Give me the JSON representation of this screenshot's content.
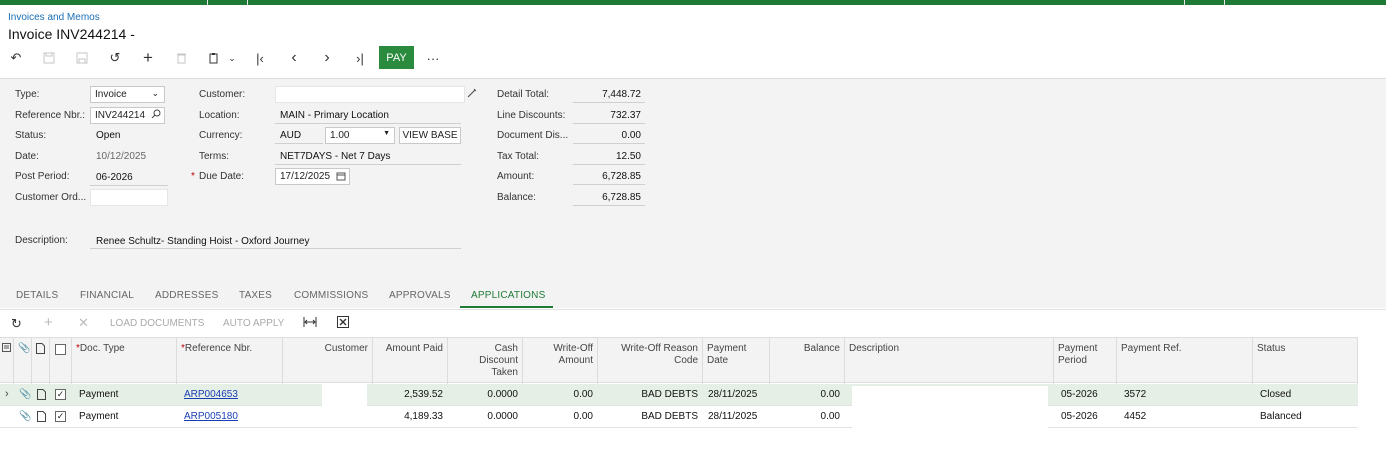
{
  "breadcrumb": "Invoices and Memos",
  "title": "Invoice INV244214 -",
  "toolbar": {
    "pay_label": "PAY",
    "more_label": "···"
  },
  "form": {
    "type_label": "Type:",
    "type_value": "Invoice",
    "refnbr_label": "Reference Nbr.:",
    "refnbr_value": "INV244214",
    "status_label": "Status:",
    "status_value": "Open",
    "date_label": "Date:",
    "date_value": "10/12/2025",
    "postperiod_label": "Post Period:",
    "postperiod_value": "06-2026",
    "customerord_label": "Customer Ord...",
    "customerord_value": "",
    "description_label": "Description:",
    "description_value": "Renee Schultz- Standing Hoist - Oxford Journey",
    "customer_label": "Customer:",
    "customer_value": "",
    "location_label": "Location:",
    "location_value": "MAIN - Primary Location",
    "currency_label": "Currency:",
    "currency_value": "AUD",
    "rate_value": "1.00",
    "view_base_label": "VIEW BASE",
    "terms_label": "Terms:",
    "terms_value": "NET7DAYS - Net 7 Days",
    "duedate_label": "Due Date:",
    "duedate_value": "17/12/2025",
    "detailtotal_label": "Detail Total:",
    "detailtotal_value": "7,448.72",
    "linediscounts_label": "Line Discounts:",
    "linediscounts_value": "732.37",
    "docdis_label": "Document Dis...",
    "docdis_value": "0.00",
    "taxtotal_label": "Tax Total:",
    "taxtotal_value": "12.50",
    "amount_label": "Amount:",
    "amount_value": "6,728.85",
    "balance_label": "Balance:",
    "balance_value": "6,728.85"
  },
  "tabs": [
    "DETAILS",
    "FINANCIAL",
    "ADDRESSES",
    "TAXES",
    "COMMISSIONS",
    "APPROVALS",
    "APPLICATIONS"
  ],
  "active_tab": "APPLICATIONS",
  "grid_toolbar": {
    "load_documents": "LOAD DOCUMENTS",
    "auto_apply": "AUTO APPLY"
  },
  "grid": {
    "headers": {
      "doc_type": "Doc. Type",
      "ref_nbr": "Reference Nbr.",
      "customer": "Customer",
      "amount_paid": "Amount Paid",
      "cash_discount_line1": "Cash",
      "cash_discount_line2": "Discount",
      "cash_discount_line3": "Taken",
      "writeoff_line1": "Write-Off",
      "writeoff_line2": "Amount",
      "writeoff_reason_line1": "Write-Off Reason",
      "writeoff_reason_line2": "Code",
      "payment_date_line1": "Payment",
      "payment_date_line2": "Date",
      "balance": "Balance",
      "description": "Description",
      "payment_period_line1": "Payment",
      "payment_period_line2": "Period",
      "payment_ref": "Payment Ref.",
      "status": "Status"
    },
    "rows": [
      {
        "doc_type": "Payment",
        "ref_nbr": "ARP004653",
        "customer": "",
        "amount_paid": "2,539.52",
        "cash_discount": "0.0000",
        "writeoff_amount": "0.00",
        "writeoff_reason": "BAD DEBTS",
        "payment_date": "28/11/2025",
        "balance": "0.00",
        "description": "",
        "payment_period": "05-2026",
        "payment_ref": "3572",
        "status": "Closed"
      },
      {
        "doc_type": "Payment",
        "ref_nbr": "ARP005180",
        "customer": "",
        "amount_paid": "4,189.33",
        "cash_discount": "0.0000",
        "writeoff_amount": "0.00",
        "writeoff_reason": "BAD DEBTS",
        "payment_date": "28/11/2025",
        "balance": "0.00",
        "description": "",
        "payment_period": "05-2026",
        "payment_ref": "4452",
        "status": "Balanced"
      }
    ]
  }
}
